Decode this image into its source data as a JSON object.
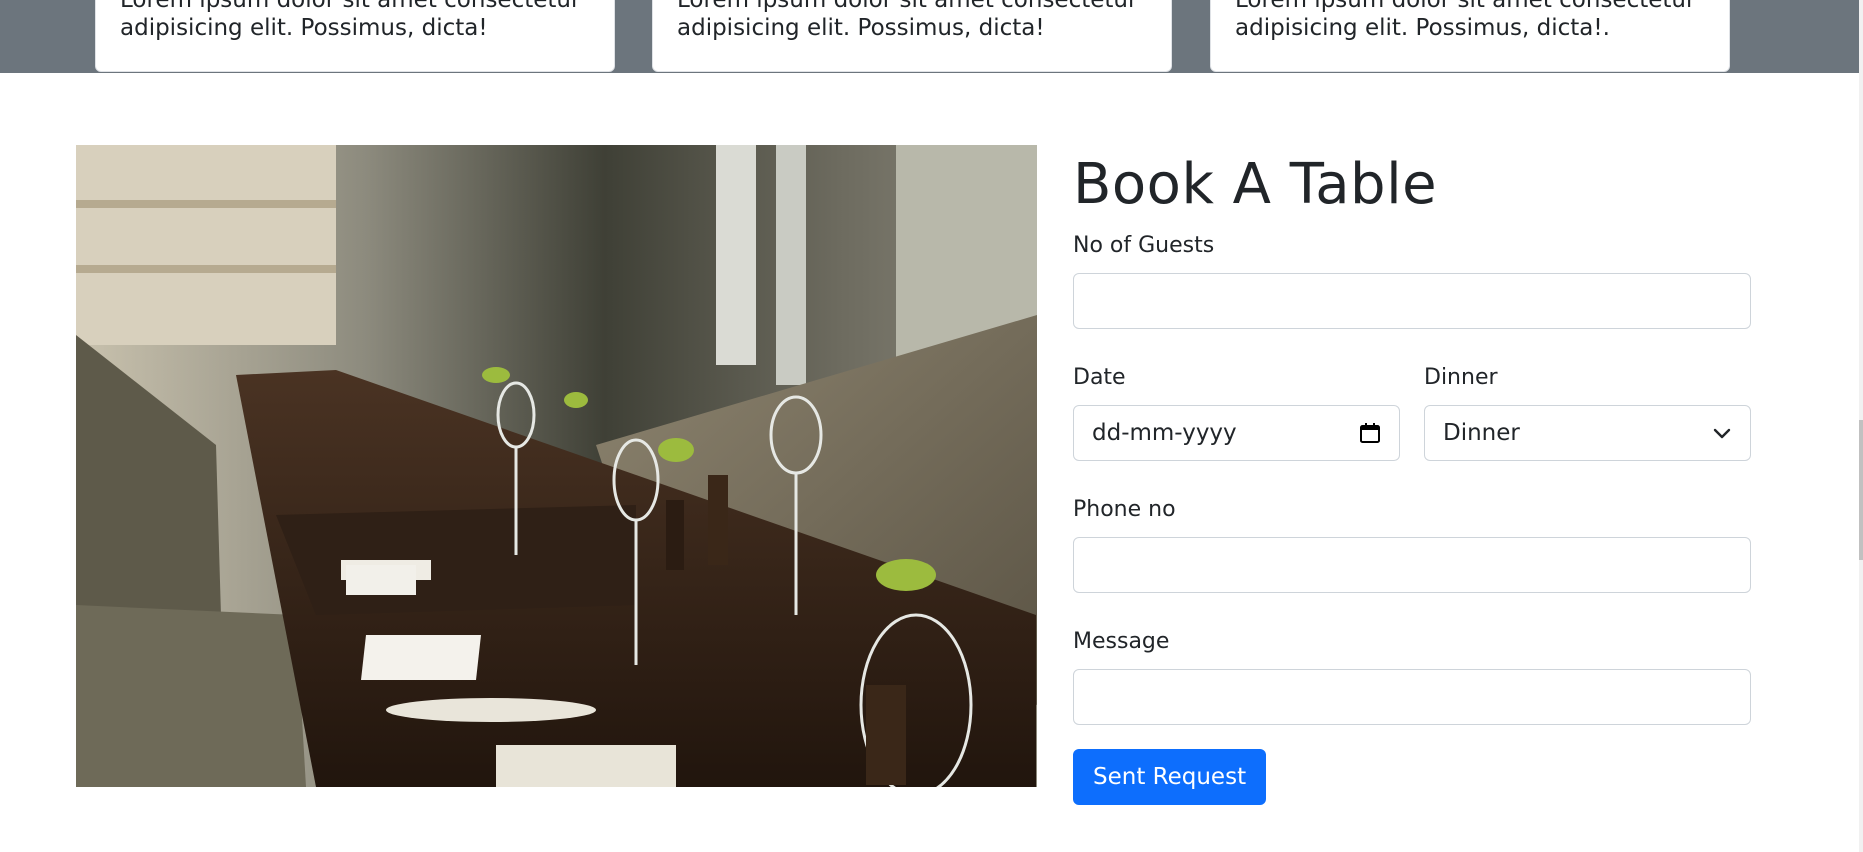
{
  "cards": [
    {
      "text_top": "Lorem ipsum dolor sit amet consectetur",
      "text": "adipisicing elit. Possimus, dicta!"
    },
    {
      "text_top": "Lorem ipsum dolor sit amet consectetur",
      "text": "adipisicing elit. Possimus, dicta!"
    },
    {
      "text_top": "Lorem ipsum dolor sit amet consectetur",
      "text": "adipisicing elit. Possimus, dicta!."
    }
  ],
  "booking": {
    "title": "Book A Table",
    "guests_label": "No of Guests",
    "guests_value": "",
    "date_label": "Date",
    "date_placeholder": "dd-mm-yyyy",
    "meal_label": "Dinner",
    "meal_selected": "Dinner",
    "phone_label": "Phone no",
    "phone_value": "",
    "message_label": "Message",
    "message_value": "",
    "submit_label": "Sent Request"
  },
  "icons": {
    "calendar": "calendar-icon",
    "chevron": "chevron-down-icon"
  },
  "colors": {
    "band": "#6c757d",
    "primary": "#0d6efd",
    "border": "#ced4da"
  }
}
